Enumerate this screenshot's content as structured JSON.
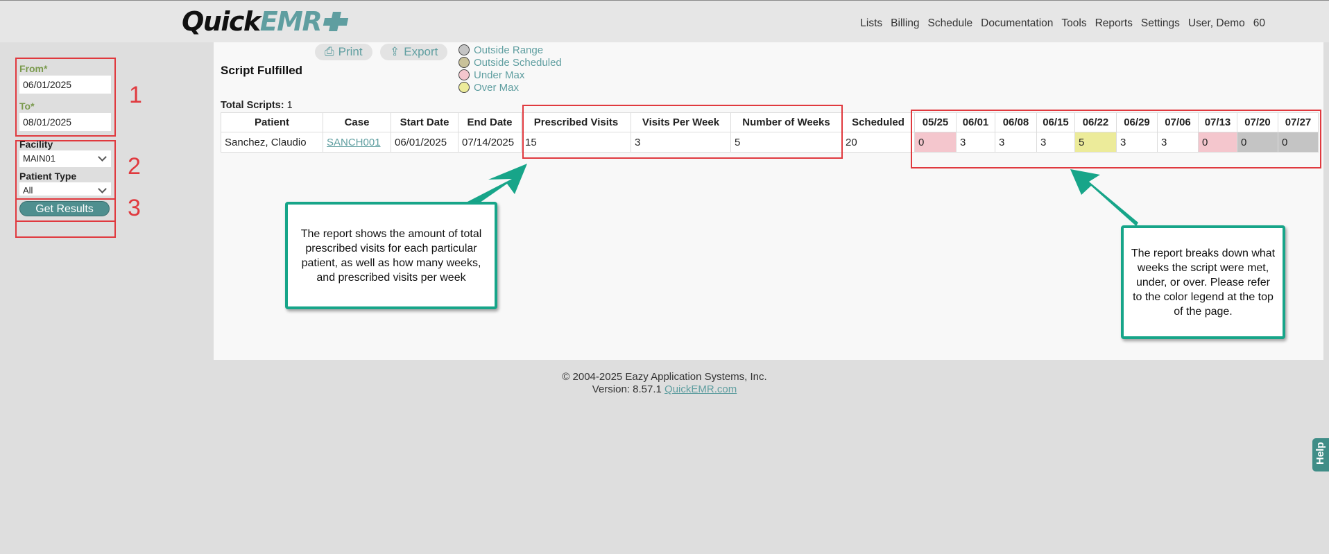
{
  "header": {
    "logo_quick": "Quick",
    "logo_emr": "EMR",
    "nav": [
      "Lists",
      "Billing",
      "Schedule",
      "Documentation",
      "Tools",
      "Reports",
      "Settings",
      "User, Demo",
      "60"
    ]
  },
  "filters": {
    "from_label": "From*",
    "from_value": "06/01/2025",
    "to_label": "To*",
    "to_value": "08/01/2025",
    "facility_label": "Facility",
    "facility_value": "MAIN01",
    "patient_type_label": "Patient Type",
    "patient_type_value": "All",
    "get_results_label": "Get Results",
    "step_numbers": [
      "1",
      "2",
      "3"
    ]
  },
  "report": {
    "print_label": "Print",
    "export_label": "Export",
    "title": "Script Fulfilled",
    "total_label": "Total Scripts:",
    "total_value": "1",
    "legend": [
      {
        "label": "Outside Range",
        "color": "#c4c4c4"
      },
      {
        "label": "Outside Scheduled",
        "color": "#c9c29a"
      },
      {
        "label": "Under Max",
        "color": "#f4c6cd"
      },
      {
        "label": "Over Max",
        "color": "#eceb9a"
      }
    ],
    "columns": [
      "Patient",
      "Case",
      "Start Date",
      "End Date",
      "Prescribed Visits",
      "Visits Per Week",
      "Number of Weeks",
      "Scheduled",
      "05/25",
      "06/01",
      "06/08",
      "06/15",
      "06/22",
      "06/29",
      "07/06",
      "07/13",
      "07/20",
      "07/27"
    ],
    "rows": [
      {
        "patient": "Sanchez, Claudio",
        "case": "SANCH001",
        "start": "06/01/2025",
        "end": "07/14/2025",
        "prescribed": "15",
        "per_week": "3",
        "weeks": "5",
        "scheduled": "20",
        "weekly": [
          "0",
          "3",
          "3",
          "3",
          "5",
          "3",
          "3",
          "0",
          "0",
          "0"
        ]
      }
    ]
  },
  "callouts": {
    "left": "The report shows the amount of total prescribed visits for each particular patient, as well as how many weeks, and prescribed visits per week",
    "right": "The report breaks down what weeks the script were met, under, or over. Please refer to the color legend at the top of the page."
  },
  "footer": {
    "copyright": "© 2004-2025 Eazy Application Systems, Inc.",
    "version": "Version: 8.57.1",
    "link": "QuickEMR.com"
  },
  "help_label": "Help"
}
